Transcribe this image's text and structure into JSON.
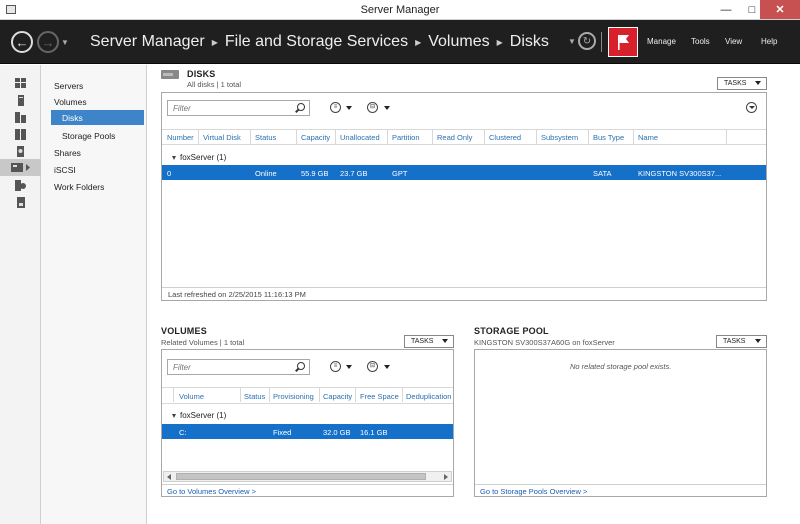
{
  "window": {
    "title": "Server Manager"
  },
  "header": {
    "breadcrumb": [
      "Server Manager",
      "File and Storage Services",
      "Volumes",
      "Disks"
    ],
    "menu": [
      "Manage",
      "Tools",
      "View",
      "Help"
    ]
  },
  "nav": {
    "items": [
      "Servers",
      "Volumes",
      "Disks",
      "Storage Pools",
      "Shares",
      "iSCSI",
      "Work Folders"
    ]
  },
  "disks": {
    "title": "DISKS",
    "subtitle": "All disks | 1 total",
    "tasks_label": "TASKS",
    "filter_placeholder": "Filter",
    "columns": [
      "Number",
      "Virtual Disk",
      "Status",
      "Capacity",
      "Unallocated",
      "Partition",
      "Read Only",
      "Clustered",
      "Subsystem",
      "Bus Type",
      "Name"
    ],
    "group": "foxServer (1)",
    "row": {
      "number": "0",
      "virtual_disk": "",
      "status": "Online",
      "capacity": "55.9 GB",
      "unallocated": "23.7 GB",
      "partition": "GPT",
      "read_only": "",
      "clustered": "",
      "subsystem": "",
      "bus_type": "SATA",
      "name": "KINGSTON SV300S37..."
    },
    "last_refreshed": "Last refreshed on 2/25/2015 11:16:13 PM"
  },
  "volumes": {
    "title": "VOLUMES",
    "subtitle": "Related Volumes | 1 total",
    "tasks_label": "TASKS",
    "filter_placeholder": "Filter",
    "columns": [
      "Volume",
      "Status",
      "Provisioning",
      "Capacity",
      "Free Space",
      "Deduplication"
    ],
    "group": "foxServer (1)",
    "row": {
      "volume": "C:",
      "status": "",
      "provisioning": "Fixed",
      "capacity": "32.0 GB",
      "free_space": "16.1 GB",
      "dedup": ""
    },
    "link": "Go to Volumes Overview >"
  },
  "storage_pool": {
    "title": "STORAGE POOL",
    "subtitle": "KINGSTON SV300S37A60G on foxServer",
    "tasks_label": "TASKS",
    "empty": "No related storage pool exists.",
    "link": "Go to Storage Pools Overview >"
  },
  "colors": {
    "selection": "#1570c9",
    "nav_selected": "#3e84c8",
    "header_bg": "#1f1f1f",
    "flag": "#d8202c",
    "link": "#1a5fb4"
  }
}
